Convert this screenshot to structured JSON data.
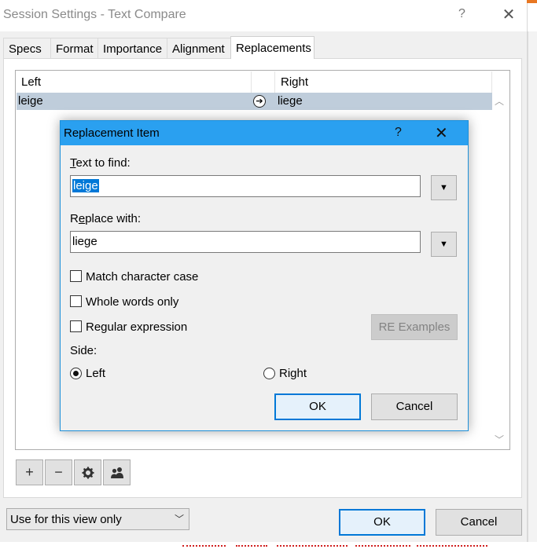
{
  "window": {
    "title": "Session Settings - Text Compare",
    "help_label": "?",
    "close_label": "✕"
  },
  "tabs": [
    {
      "label": "Specs"
    },
    {
      "label": "Format"
    },
    {
      "label": "Importance"
    },
    {
      "label": "Alignment"
    },
    {
      "label": "Replacements",
      "active": true
    }
  ],
  "list": {
    "columns": {
      "left": "Left",
      "right": "Right"
    },
    "rows": [
      {
        "left": "leige",
        "arrow": "➔",
        "right": "liege"
      }
    ]
  },
  "toolbar": {
    "add_label": "+",
    "remove_label": "−"
  },
  "footer": {
    "scope_value": "Use for this view only",
    "ok_label": "OK",
    "cancel_label": "Cancel"
  },
  "dialog": {
    "title": "Replacement Item",
    "help_label": "?",
    "close_label": "✕",
    "find_label_underline": "T",
    "find_label_rest": "ext to find:",
    "find_value": "leige",
    "replace_label_prefix": "R",
    "replace_label_underline": "e",
    "replace_label_rest": "place with:",
    "replace_value": "liege",
    "options": {
      "match_case": "Match character case",
      "whole_words": "Whole words only",
      "regex": "Regular expression"
    },
    "re_examples_label": "RE Examples",
    "side_label": "Side:",
    "side_left": "Left",
    "side_right": "Right",
    "ok_label": "OK",
    "cancel_label": "Cancel"
  },
  "colors": {
    "dialog_titlebar": "#2aa0f0",
    "selection": "#0078d7",
    "row_highlight": "#bfcddb"
  }
}
